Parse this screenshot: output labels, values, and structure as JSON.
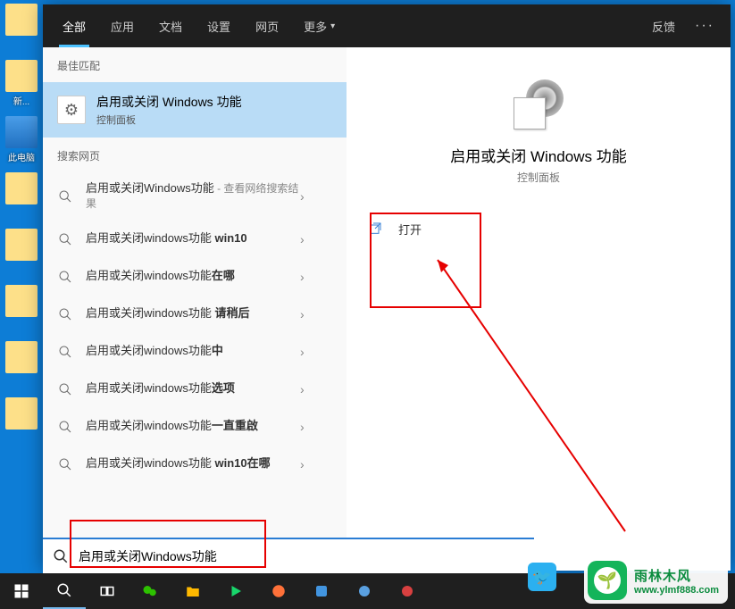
{
  "desktop": {
    "icons": [
      {
        "label": ""
      },
      {
        "label": "新..."
      },
      {
        "label": "此电脑"
      },
      {
        "label": ""
      },
      {
        "label": ""
      },
      {
        "label": ""
      },
      {
        "label": ""
      },
      {
        "label": ""
      }
    ]
  },
  "tabs": {
    "items": [
      "全部",
      "应用",
      "文档",
      "设置",
      "网页"
    ],
    "more": "更多",
    "active_index": 0,
    "feedback": "反馈",
    "dots": "···"
  },
  "sections": {
    "best_match": "最佳匹配",
    "search_web": "搜索网页"
  },
  "best_match": {
    "title": "启用或关闭 Windows 功能",
    "subtitle": "控制面板"
  },
  "suggestions": [
    {
      "prefix": "启用或关闭Windows功能",
      "bold": "",
      "suffix": " - 查看网络搜索结果"
    },
    {
      "prefix": "启用或关闭windows功能 ",
      "bold": "win10",
      "suffix": ""
    },
    {
      "prefix": "启用或关闭windows功能",
      "bold": "在哪",
      "suffix": ""
    },
    {
      "prefix": "启用或关闭windows功能 ",
      "bold": "请稍后",
      "suffix": ""
    },
    {
      "prefix": "启用或关闭windows功能",
      "bold": "中",
      "suffix": ""
    },
    {
      "prefix": "启用或关闭windows功能",
      "bold": "选项",
      "suffix": ""
    },
    {
      "prefix": "启用或关闭windows功能",
      "bold": "一直重啟",
      "suffix": ""
    },
    {
      "prefix": "启用或关闭windows功能 ",
      "bold": "win10在哪",
      "suffix": ""
    }
  ],
  "preview": {
    "title": "启用或关闭 Windows 功能",
    "subtitle": "控制面板",
    "action_open": "打开"
  },
  "search": {
    "value": "启用或关闭Windows功能"
  },
  "watermark": {
    "line1": "雨林木风",
    "line2": "www.ylmf888.com"
  }
}
